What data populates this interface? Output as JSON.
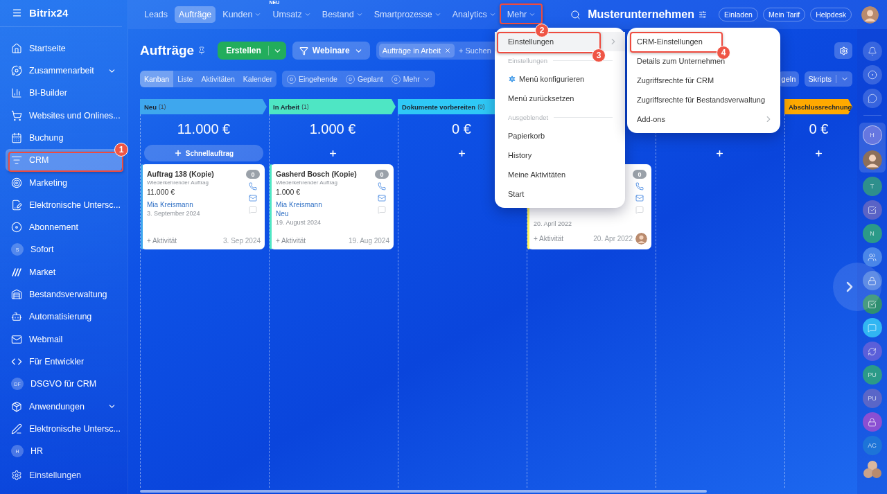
{
  "sidebar": {
    "logo": "Bitrix24",
    "items": [
      {
        "label": "Startseite",
        "kind": "icon",
        "selected": false,
        "expandable": false
      },
      {
        "label": "Zusammenarbeit",
        "kind": "icon",
        "selected": false,
        "expandable": true
      },
      {
        "label": "BI-Builder",
        "kind": "icon",
        "selected": false,
        "expandable": false
      },
      {
        "label": "Websites und Onlines...",
        "kind": "icon",
        "selected": false,
        "expandable": false
      },
      {
        "label": "Buchung",
        "kind": "icon",
        "selected": false,
        "expandable": false
      },
      {
        "label": "CRM",
        "kind": "icon",
        "selected": true,
        "expandable": false
      },
      {
        "label": "Marketing",
        "kind": "icon",
        "selected": false,
        "expandable": false
      },
      {
        "label": "Elektronische Untersc...",
        "kind": "icon",
        "selected": false,
        "expandable": false
      },
      {
        "label": "Abonnement",
        "kind": "icon",
        "selected": false,
        "expandable": false
      },
      {
        "label": "Sofort",
        "kind": "initials",
        "initials": "S",
        "selected": false,
        "expandable": false
      },
      {
        "label": "Market",
        "kind": "icon",
        "selected": false,
        "expandable": false
      },
      {
        "label": "Bestandsverwaltung",
        "kind": "icon",
        "selected": false,
        "expandable": false
      },
      {
        "label": "Automatisierung",
        "kind": "icon",
        "selected": false,
        "expandable": false
      },
      {
        "label": "Webmail",
        "kind": "icon",
        "selected": false,
        "expandable": false
      },
      {
        "label": "Für Entwickler",
        "kind": "icon",
        "selected": false,
        "expandable": false
      },
      {
        "label": "DSGVO für CRM",
        "kind": "initials",
        "initials": "DF",
        "selected": false,
        "expandable": false
      },
      {
        "label": "Anwendungen",
        "kind": "icon",
        "selected": false,
        "expandable": true
      },
      {
        "label": "Elektronische Untersc...",
        "kind": "icon",
        "selected": false,
        "expandable": false
      },
      {
        "label": "HR",
        "kind": "initials",
        "initials": "H",
        "selected": false,
        "expandable": false
      }
    ],
    "footer": "Einstellungen"
  },
  "topnav": {
    "tabs": [
      {
        "label": "Leads",
        "selected": false,
        "dropdown": false
      },
      {
        "label": "Aufträge",
        "selected": true,
        "dropdown": false
      },
      {
        "label": "Kunden",
        "selected": false,
        "dropdown": true
      },
      {
        "label": "Umsatz",
        "selected": false,
        "dropdown": true,
        "badge": "NEU"
      },
      {
        "label": "Bestand",
        "selected": false,
        "dropdown": true
      },
      {
        "label": "Smartprozesse",
        "selected": false,
        "dropdown": true
      },
      {
        "label": "Analytics",
        "selected": false,
        "dropdown": true
      },
      {
        "label": "Mehr",
        "selected": false,
        "dropdown": true
      }
    ],
    "company": "Musterunternehmen",
    "buttons": [
      "Einladen",
      "Mein Tarif",
      "Helpdesk"
    ]
  },
  "toolbar": {
    "title": "Aufträge",
    "create": "Erstellen",
    "pipeline": "Webinare",
    "filter_tag": "Aufträge in Arbeit",
    "search_placeholder": "+ Suchen",
    "views": [
      {
        "label": "Kanban",
        "selected": true
      },
      {
        "label": "Liste",
        "selected": false
      },
      {
        "label": "Aktivitäten",
        "selected": false
      },
      {
        "label": "Kalender",
        "selected": false
      }
    ],
    "counters": [
      {
        "count": "0",
        "label": "Eingehende",
        "dropdown": false
      },
      {
        "count": "0",
        "label": "Geplant",
        "dropdown": false
      },
      {
        "count": "0",
        "label": "Mehr",
        "dropdown": true
      }
    ],
    "rules_button": "geln",
    "scripts_button": "Skripts"
  },
  "kanban": {
    "columns": [
      {
        "title": "Neu",
        "count": "(1)",
        "color": "#3ea7ee",
        "total": "11.000 €",
        "add": {
          "kind": "quick",
          "label": "Schnellauftrag"
        },
        "cards": [
          {
            "title": "Auftrag 138 (Kopie)",
            "subtitle": "Wiederkehrender Auftrag",
            "amount": "11.000 €",
            "contact": "Mia Kreismann",
            "date": "3. September 2024",
            "activity": "+ Aktivität",
            "footer_date": "3. Sep 2024",
            "badge": "0"
          }
        ]
      },
      {
        "title": "In Arbeit",
        "count": "(1)",
        "color": "#4ee6c4",
        "total": "1.000 €",
        "add": {
          "kind": "plus"
        },
        "cards": [
          {
            "title": "Gasherd Bosch (Kopie)",
            "subtitle": "Wiederkehrender Auftrag",
            "amount": "1.000 €",
            "contact": "Mia Kreismann",
            "stage": "Neu",
            "date": "19. August 2024",
            "activity": "+ Aktivität",
            "footer_date": "19. Aug 2024",
            "badge": "0"
          }
        ]
      },
      {
        "title": "Dokumente vorbereiten",
        "count": "(0)",
        "color": "#2fc8f6",
        "total": "0 €",
        "add": {
          "kind": "plus"
        }
      },
      {
        "color": "#fff35c",
        "cards": [
          {
            "date": "20. April 2022",
            "activity": "+ Aktivität",
            "footer_date": "20. Apr 2022",
            "badge": "0",
            "avatar": true
          }
        ]
      },
      {
        "add": {
          "kind": "plus"
        }
      },
      {
        "title": "Abschlussrechnung",
        "color": "#ffa900",
        "total": "0 €",
        "add": {
          "kind": "plus"
        }
      }
    ]
  },
  "menu": {
    "items": [
      {
        "kind": "item",
        "label": "Einstellungen",
        "selected": true,
        "submenu": true
      },
      {
        "kind": "section",
        "label": "Einstellungen"
      },
      {
        "kind": "item",
        "label": "Menü konfigurieren",
        "selected": false,
        "submenu": false,
        "gear": true
      },
      {
        "kind": "item",
        "label": "Menü zurücksetzen",
        "selected": false,
        "submenu": false
      },
      {
        "kind": "section",
        "label": "Ausgeblendet"
      },
      {
        "kind": "item",
        "label": "Papierkorb",
        "selected": false,
        "submenu": false
      },
      {
        "kind": "item",
        "label": "History",
        "selected": false,
        "submenu": false
      },
      {
        "kind": "item",
        "label": "Meine Aktivitäten",
        "selected": false,
        "submenu": false
      },
      {
        "kind": "item",
        "label": "Start",
        "selected": false,
        "submenu": false
      }
    ]
  },
  "submenu": {
    "items": [
      {
        "label": "CRM-Einstellungen",
        "selected": false,
        "submenu": false
      },
      {
        "label": "Details zum Unternehmen",
        "selected": false,
        "submenu": false
      },
      {
        "label": "Zugriffsrechte für CRM",
        "selected": false,
        "submenu": false
      },
      {
        "label": "Zugriffsrechte für Bestandsverwaltung",
        "selected": false,
        "submenu": false
      },
      {
        "label": "Add-ons",
        "selected": false,
        "submenu": true
      }
    ]
  },
  "right_rail": {
    "active_group": [
      {
        "kind": "initials",
        "initials": "H",
        "color": "#6677e0"
      },
      {
        "kind": "avatar"
      }
    ],
    "chats": [
      {
        "kind": "initials",
        "initials": "T",
        "color": "#2e8f8c"
      },
      {
        "kind": "icon",
        "color": "#5a63c6"
      },
      {
        "kind": "initials",
        "initials": "N",
        "color": "#2b9a88"
      },
      {
        "kind": "icon",
        "color": "#4a86e8"
      },
      {
        "kind": "icon",
        "color": "#4a7ee2"
      },
      {
        "kind": "icon",
        "color": "#2f8f70"
      },
      {
        "kind": "icon",
        "color": "#31b6f2"
      },
      {
        "kind": "icon",
        "color": "#5b5fd9"
      },
      {
        "kind": "initials",
        "initials": "PU",
        "color": "#2b9a88"
      },
      {
        "kind": "initials",
        "initials": "PU",
        "color": "#5a66c8"
      },
      {
        "kind": "icon",
        "color": "#8a4fd2"
      },
      {
        "kind": "initials",
        "initials": "AC",
        "color": "#1d74d8"
      },
      {
        "kind": "group"
      }
    ]
  },
  "callouts": [
    {
      "number": "1"
    },
    {
      "number": "2"
    },
    {
      "number": "3"
    },
    {
      "number": "4"
    }
  ]
}
